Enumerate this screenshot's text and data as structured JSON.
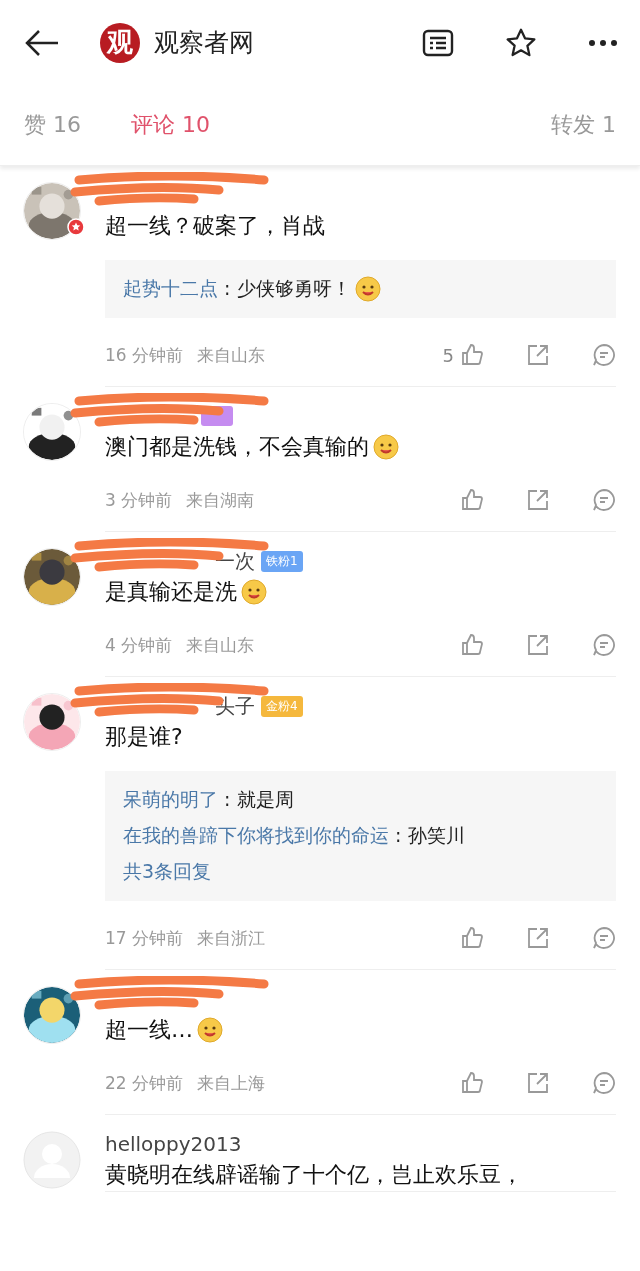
{
  "header": {
    "logo": "观",
    "title": "观察者网"
  },
  "tabs": [
    {
      "label": "赞 16",
      "selected": false
    },
    {
      "label": "评论 10",
      "selected": true
    },
    {
      "label": "转发 1",
      "selected": false
    }
  ],
  "comments": [
    {
      "avatar": {
        "kind": "picture",
        "verified": true
      },
      "redacted": true,
      "text": "超一线？破案了，肖战",
      "emoji": false,
      "replies": [
        {
          "author": "起势十二点",
          "separator": ":",
          "text": "少侠够勇呀！",
          "emoji": true
        }
      ],
      "time": "16 分钟前",
      "location": "来自山东",
      "likes": "5"
    },
    {
      "avatar": {
        "kind": "picture",
        "verified": false
      },
      "redacted": true,
      "badge": {
        "color": "#c58cf0"
      },
      "text": "澳门都是洗钱，不会真输的",
      "emoji": true,
      "time": "3 分钟前",
      "location": "来自湖南"
    },
    {
      "avatar": {
        "kind": "picture",
        "verified": false
      },
      "redacted": true,
      "username": "一次",
      "badge": {
        "label": "铁粉1",
        "color": "#6aa5f5"
      },
      "text": "是真输还是洗",
      "emoji": true,
      "time": "4 分钟前",
      "location": "来自山东"
    },
    {
      "avatar": {
        "kind": "picture",
        "verified": false
      },
      "redacted": true,
      "username": "头子",
      "badge": {
        "label": "金粉4",
        "color": "#f5b83d"
      },
      "text": "那是谁?",
      "emoji": false,
      "replies": [
        {
          "author": "呆萌的明了",
          "separator": ":",
          "text": "就是周",
          "emoji": false
        },
        {
          "author": "在我的兽蹄下你将找到你的命运",
          "separator": ":",
          "text": "孙笑川",
          "emoji": false
        }
      ],
      "more": "共3条回复",
      "time": "17 分钟前",
      "location": "来自浙江"
    },
    {
      "avatar": {
        "kind": "picture",
        "verified": false
      },
      "redacted": true,
      "text": "超一线…",
      "emoji": true,
      "time": "22 分钟前",
      "location": "来自上海"
    },
    {
      "avatar": {
        "kind": "placeholder",
        "verified": false
      },
      "redacted": false,
      "username": "helloppy2013",
      "text": "黄晓明在线辟谣输了十个亿，岂止欢乐豆，"
    }
  ]
}
